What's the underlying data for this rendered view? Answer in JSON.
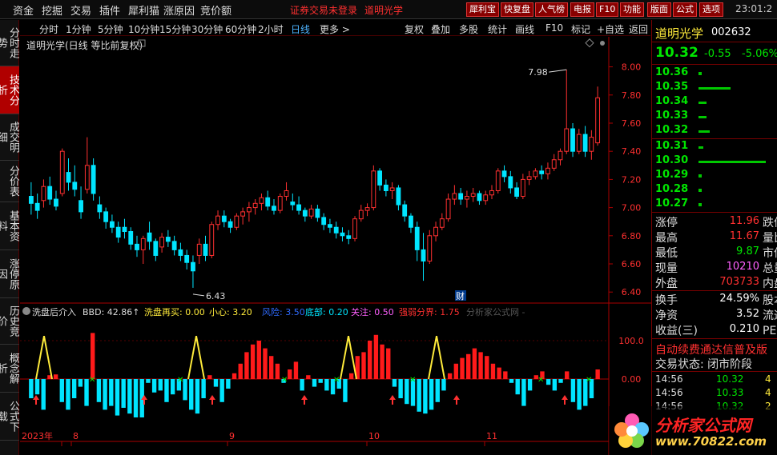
{
  "menu": {
    "items": [
      "资金",
      "挖掘",
      "交易",
      "插件",
      "犀利猫",
      "涨原因",
      "竞价额"
    ],
    "warning": "证券交易未登录",
    "stock_link": "道明光学",
    "buttons": [
      "犀利宝",
      "快复盘",
      "人气榜",
      "电报",
      "F10",
      "功能",
      "版面",
      "公式",
      "选项"
    ],
    "clock": "23:01:2",
    "controls": [
      "—",
      "□",
      "✕"
    ]
  },
  "left_nav": {
    "tabs": [
      "分时走势",
      "技术分析",
      "成交明细",
      "分价表",
      "基本资料",
      "涨停原因",
      "历史竞价",
      "概念解析",
      "公式下载"
    ],
    "active": 1
  },
  "period_bar": {
    "periods": [
      "分时",
      "1分钟",
      "5分钟",
      "10分钟",
      "15分钟",
      "30分钟",
      "60分钟",
      "2小时",
      "日线",
      "更多 >"
    ],
    "active": 8,
    "tools": [
      "复权",
      "叠加",
      "多股",
      "统计",
      "画线",
      "F10",
      "标记",
      "+自选",
      "返回"
    ]
  },
  "chart_title": "道明光学(日线 等比前复权)",
  "indicator": {
    "items": [
      {
        "text": "洗盘后介入",
        "color": "#dddddd"
      },
      {
        "text": "BBD: 42.86↑",
        "color": "#dddddd"
      },
      {
        "text": "洗盘再买: 0.00",
        "color": "#ffeb3b"
      },
      {
        "text": "小心: 3.20",
        "color": "#ffeb3b"
      },
      {
        "text": "风险: 3.50",
        "color": "#2f6bff"
      },
      {
        "text": "底部: 0.20",
        "color": "#00e5ff"
      },
      {
        "text": "关注: 0.50",
        "color": "#ff60ff"
      },
      {
        "text": "强弱分界: 1.75",
        "color": "#ff3030"
      },
      {
        "text": "分析家公式网 -",
        "color": "#555555"
      }
    ]
  },
  "chart_data": [
    {
      "type": "candlestick",
      "ylim": [
        6.35,
        8.1
      ],
      "y_ticks": [
        "8.00",
        "7.80",
        "7.60",
        "7.40",
        "7.20",
        "7.00",
        "6.80",
        "6.60",
        "6.40"
      ],
      "annotations": {
        "high": "7.98",
        "low": "6.43",
        "marker": "财"
      },
      "candles": [
        [
          7.08,
          7.18,
          6.95,
          7.03
        ],
        [
          7.03,
          7.1,
          6.92,
          6.98
        ],
        [
          7.05,
          7.2,
          7.0,
          7.15
        ],
        [
          7.15,
          7.22,
          7.02,
          7.06
        ],
        [
          7.06,
          7.12,
          6.98,
          7.01
        ],
        [
          7.1,
          7.42,
          7.08,
          7.4
        ],
        [
          7.25,
          7.35,
          7.12,
          7.18
        ],
        [
          7.18,
          7.3,
          7.08,
          7.13
        ],
        [
          7.05,
          7.15,
          6.92,
          6.97
        ],
        [
          7.13,
          7.5,
          7.1,
          7.3
        ],
        [
          7.3,
          7.35,
          7.05,
          7.1
        ],
        [
          7.02,
          7.08,
          6.92,
          6.97
        ],
        [
          6.97,
          7.0,
          6.85,
          6.9
        ],
        [
          6.9,
          6.95,
          6.82,
          6.86
        ],
        [
          6.86,
          6.9,
          6.75,
          6.79
        ],
        [
          6.86,
          6.92,
          6.78,
          6.83
        ],
        [
          6.83,
          6.86,
          6.7,
          6.74
        ],
        [
          6.74,
          6.8,
          6.65,
          6.7
        ],
        [
          6.7,
          6.8,
          6.6,
          6.78
        ],
        [
          6.82,
          6.9,
          6.7,
          6.76
        ],
        [
          6.76,
          6.78,
          6.62,
          6.66
        ],
        [
          6.72,
          6.82,
          6.68,
          6.79
        ],
        [
          6.79,
          6.84,
          6.72,
          6.76
        ],
        [
          6.76,
          6.8,
          6.66,
          6.7
        ],
        [
          6.7,
          6.75,
          6.62,
          6.66
        ],
        [
          6.66,
          6.7,
          6.56,
          6.61
        ],
        [
          6.61,
          6.66,
          6.43,
          6.55
        ],
        [
          6.66,
          6.78,
          6.6,
          6.74
        ],
        [
          6.74,
          6.8,
          6.62,
          6.66
        ],
        [
          6.66,
          6.9,
          6.64,
          6.88
        ],
        [
          6.88,
          6.98,
          6.84,
          6.94
        ],
        [
          6.94,
          6.98,
          6.86,
          6.9
        ],
        [
          6.9,
          6.92,
          6.82,
          6.86
        ],
        [
          6.86,
          6.96,
          6.84,
          6.94
        ],
        [
          6.94,
          7.0,
          6.88,
          6.97
        ],
        [
          6.97,
          7.04,
          6.9,
          7.0
        ],
        [
          7.0,
          7.06,
          6.95,
          7.03
        ],
        [
          7.03,
          7.1,
          6.98,
          7.07
        ],
        [
          7.07,
          7.12,
          6.98,
          7.01
        ],
        [
          7.01,
          7.06,
          6.95,
          6.98
        ],
        [
          6.98,
          7.1,
          6.96,
          7.08
        ],
        [
          7.08,
          7.18,
          7.05,
          7.12
        ],
        [
          7.04,
          7.1,
          6.98,
          7.02
        ],
        [
          7.02,
          7.08,
          6.95,
          6.98
        ],
        [
          6.98,
          7.0,
          6.9,
          6.94
        ],
        [
          6.94,
          7.02,
          6.92,
          6.99
        ],
        [
          6.99,
          7.02,
          6.9,
          6.93
        ],
        [
          6.93,
          6.96,
          6.84,
          6.88
        ],
        [
          6.88,
          6.92,
          6.82,
          6.86
        ],
        [
          6.86,
          6.9,
          6.78,
          6.82
        ],
        [
          6.82,
          6.86,
          6.76,
          6.8
        ],
        [
          6.8,
          6.84,
          6.74,
          6.78
        ],
        [
          6.78,
          6.94,
          6.76,
          6.92
        ],
        [
          6.92,
          7.02,
          6.9,
          6.98
        ],
        [
          6.98,
          7.03,
          6.94,
          7.0
        ],
        [
          7.0,
          7.3,
          6.98,
          7.26
        ],
        [
          7.26,
          7.28,
          7.12,
          7.16
        ],
        [
          7.16,
          7.2,
          7.08,
          7.12
        ],
        [
          7.12,
          7.18,
          7.06,
          7.14
        ],
        [
          7.14,
          7.16,
          6.98,
          7.02
        ],
        [
          7.02,
          7.05,
          6.9,
          6.94
        ],
        [
          6.94,
          6.96,
          6.82,
          6.86
        ],
        [
          6.86,
          6.9,
          6.62,
          6.7
        ],
        [
          6.7,
          6.82,
          6.48,
          6.62
        ],
        [
          6.62,
          6.84,
          6.6,
          6.8
        ],
        [
          6.8,
          6.9,
          6.76,
          6.86
        ],
        [
          6.86,
          6.96,
          6.84,
          6.92
        ],
        [
          6.92,
          7.1,
          6.9,
          7.06
        ],
        [
          7.06,
          7.16,
          7.02,
          7.1
        ],
        [
          7.1,
          7.14,
          7.02,
          7.06
        ],
        [
          7.06,
          7.12,
          7.0,
          7.08
        ],
        [
          7.08,
          7.14,
          7.04,
          7.1
        ],
        [
          7.1,
          7.12,
          7.02,
          7.05
        ],
        [
          7.05,
          7.12,
          7.02,
          7.09
        ],
        [
          7.09,
          7.16,
          7.06,
          7.12
        ],
        [
          7.12,
          7.28,
          7.1,
          7.26
        ],
        [
          7.26,
          7.3,
          7.18,
          7.22
        ],
        [
          7.22,
          7.26,
          7.1,
          7.14
        ],
        [
          7.14,
          7.18,
          7.06,
          7.08
        ],
        [
          7.08,
          7.24,
          7.06,
          7.2
        ],
        [
          7.2,
          7.26,
          7.16,
          7.22
        ],
        [
          7.22,
          7.28,
          7.2,
          7.26
        ],
        [
          7.26,
          7.3,
          7.2,
          7.24
        ],
        [
          7.24,
          7.32,
          7.2,
          7.28
        ],
        [
          7.28,
          7.38,
          7.26,
          7.34
        ],
        [
          7.34,
          7.42,
          7.3,
          7.4
        ],
        [
          7.4,
          7.98,
          7.38,
          7.56
        ],
        [
          7.56,
          7.6,
          7.36,
          7.4
        ],
        [
          7.4,
          7.56,
          7.38,
          7.52
        ],
        [
          7.52,
          7.58,
          7.36,
          7.4
        ],
        [
          7.4,
          7.55,
          7.34,
          7.5
        ],
        [
          7.46,
          7.86,
          7.44,
          7.78
        ]
      ]
    },
    {
      "type": "bar",
      "ylim": [
        -150,
        150
      ],
      "y_ticks": [
        "100.0",
        "0.00"
      ],
      "values": [
        -50,
        -40,
        -80,
        10,
        12,
        -60,
        -80,
        -50,
        -20,
        -70,
        120,
        -60,
        -80,
        -70,
        -95,
        -75,
        -90,
        -100,
        -100,
        -10,
        -35,
        -30,
        -60,
        -40,
        -30,
        -55,
        -80,
        -90,
        -50,
        10,
        -20,
        -60,
        -25,
        15,
        40,
        70,
        90,
        100,
        80,
        60,
        40,
        -10,
        25,
        45,
        -30,
        10,
        -20,
        -10,
        -30,
        -40,
        -25,
        -60,
        15,
        60,
        70,
        100,
        115,
        90,
        80,
        -20,
        -50,
        -65,
        -70,
        -85,
        -90,
        -80,
        -60,
        -30,
        15,
        40,
        55,
        65,
        80,
        70,
        60,
        40,
        30,
        20,
        -10,
        -40,
        -70,
        -30,
        10,
        20,
        -15,
        -30,
        -10,
        20,
        -60,
        -80,
        -70,
        -50,
        25
      ]
    }
  ],
  "quote": {
    "name": "道明光学",
    "code": "002632",
    "price": "10.32",
    "change": "-0.55",
    "pct": "-5.06%",
    "asks": [
      {
        "p": "10.36",
        "bar": 0
      },
      {
        "p": "10.35",
        "bar": 40
      },
      {
        "p": "10.34",
        "bar": 10
      },
      {
        "p": "10.33",
        "bar": 10
      },
      {
        "p": "10.32",
        "bar": 14
      }
    ],
    "bids": [
      {
        "p": "10.31",
        "bar": 6
      },
      {
        "p": "10.30",
        "bar": 84
      },
      {
        "p": "10.29",
        "bar": 0
      },
      {
        "p": "10.28",
        "bar": 0
      },
      {
        "p": "10.27",
        "bar": 0
      }
    ],
    "stats1": [
      {
        "l": "涨停",
        "v": "11.96",
        "c": "#ff3030",
        "r": "跌停"
      },
      {
        "l": "最高",
        "v": "11.67",
        "c": "#ff3030",
        "r": "量比"
      },
      {
        "l": "最低",
        "v": "9.87",
        "c": "#00e600",
        "r": "市值"
      },
      {
        "l": "现量",
        "v": "10210",
        "c": "#ff60ff",
        "r": "总量"
      },
      {
        "l": "外盘",
        "v": "703733",
        "c": "#ff3030",
        "r": "内盘"
      }
    ],
    "stats2": [
      {
        "l": "换手",
        "v": "24.59%",
        "c": "#ffffff",
        "r": "股本"
      },
      {
        "l": "净资",
        "v": "3.52",
        "c": "#ffffff",
        "r": "流通"
      },
      {
        "l": "收益(三)",
        "v": "0.210",
        "c": "#ffffff",
        "r": "PE(动)"
      }
    ],
    "ticker": "自动续费通达信普及版",
    "trade_status": "交易状态: 闭市阶段",
    "ticks": [
      {
        "t": "14:56",
        "p": "10.32",
        "v": "4"
      },
      {
        "t": "14:56",
        "p": "10.33",
        "v": "4"
      },
      {
        "t": "14:56",
        "p": "10.32",
        "v": "2"
      }
    ]
  },
  "date_axis": {
    "labels": [
      "2023年",
      "8",
      "9",
      "10",
      "11"
    ]
  },
  "logo": {
    "name": "分析家公式网",
    "url": "www.70822.com"
  }
}
